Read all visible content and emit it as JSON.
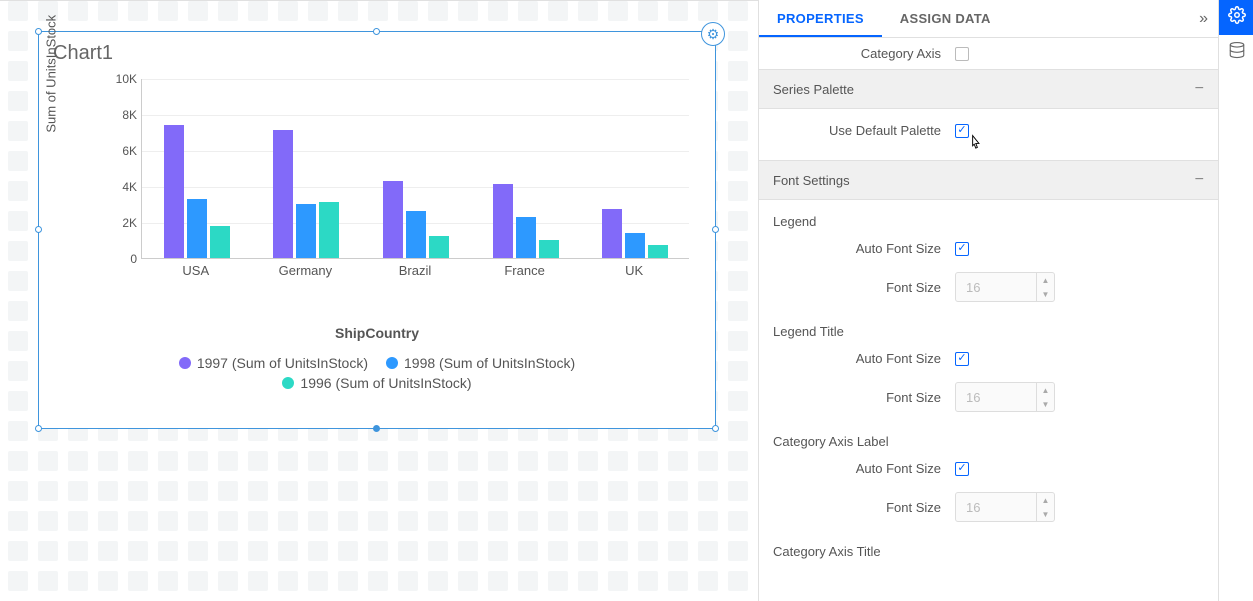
{
  "chart_data": {
    "type": "bar",
    "categories": [
      "USA",
      "Germany",
      "Brazil",
      "France",
      "UK"
    ],
    "series": [
      {
        "name": "1997 (Sum of UnitsInStock)",
        "color": "#826af9",
        "values": [
          7400,
          7100,
          4300,
          4100,
          2700
        ]
      },
      {
        "name": "1998 (Sum of UnitsInStock)",
        "color": "#2d99ff",
        "values": [
          3300,
          3000,
          2600,
          2300,
          1400
        ]
      },
      {
        "name": "1996 (Sum of UnitsInStock)",
        "color": "#2cd9c5",
        "values": [
          1800,
          3100,
          1200,
          1000,
          700
        ]
      }
    ],
    "title": "Chart1",
    "xlabel": "ShipCountry",
    "ylabel": "Sum of UnitsInStock",
    "ylim": [
      0,
      10000
    ],
    "y_ticks": [
      "0",
      "2K",
      "4K",
      "6K",
      "8K",
      "10K"
    ]
  },
  "panel": {
    "tabs": {
      "properties": "PROPERTIES",
      "assign": "ASSIGN DATA"
    },
    "category_axis": {
      "label": "Category Axis",
      "checked": false
    },
    "series_palette": {
      "title": "Series Palette",
      "use_default_label": "Use Default Palette",
      "use_default_checked": true
    },
    "font_settings": {
      "title": "Font Settings",
      "legend": {
        "heading": "Legend",
        "auto_label": "Auto Font Size",
        "auto_checked": true,
        "size_label": "Font Size",
        "size_value": "16"
      },
      "legend_title": {
        "heading": "Legend Title",
        "auto_label": "Auto Font Size",
        "auto_checked": true,
        "size_label": "Font Size",
        "size_value": "16"
      },
      "cat_axis_label": {
        "heading": "Category Axis Label",
        "auto_label": "Auto Font Size",
        "auto_checked": true,
        "size_label": "Font Size",
        "size_value": "16"
      },
      "cat_axis_title": {
        "heading": "Category Axis Title"
      }
    }
  }
}
